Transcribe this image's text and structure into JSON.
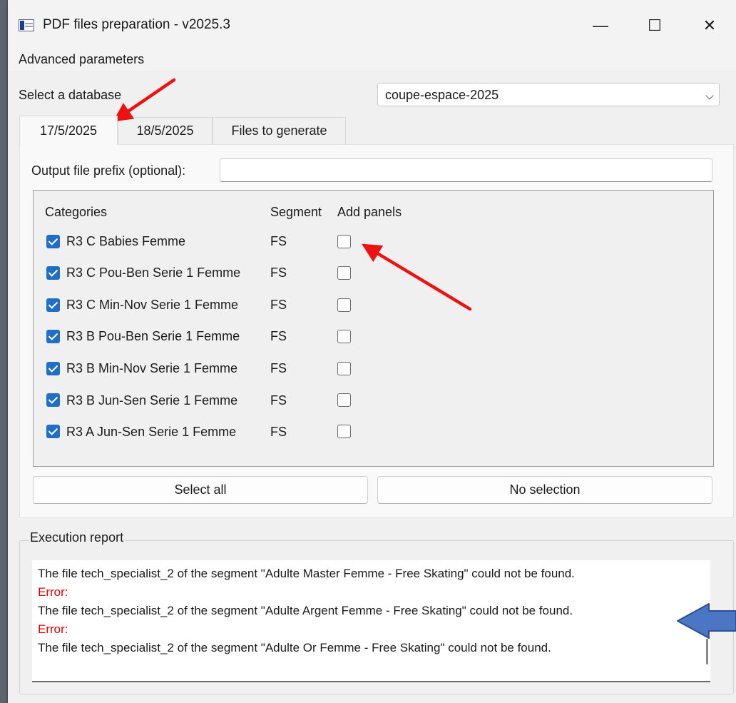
{
  "window": {
    "title": "PDF files preparation - v2025.3",
    "minimize_glyph": "—",
    "maximize_glyph": "☐",
    "close_glyph": "✕"
  },
  "menu": {
    "advanced_parameters": "Advanced parameters"
  },
  "database": {
    "label": "Select a database",
    "selected": "coupe-espace-2025"
  },
  "tabs": [
    {
      "label": "17/5/2025",
      "active": true
    },
    {
      "label": "18/5/2025",
      "active": false
    },
    {
      "label": "Files to generate",
      "active": false
    }
  ],
  "prefix": {
    "label": "Output file prefix (optional):",
    "value": ""
  },
  "categories": {
    "headers": {
      "categories": "Categories",
      "segment": "Segment",
      "add_panels": "Add panels"
    },
    "rows": [
      {
        "name": "R3 C Babies Femme",
        "segment": "FS",
        "selected": true,
        "add_panels": false
      },
      {
        "name": "R3 C Pou-Ben Serie 1 Femme",
        "segment": "FS",
        "selected": true,
        "add_panels": false
      },
      {
        "name": "R3 C Min-Nov Serie 1 Femme",
        "segment": "FS",
        "selected": true,
        "add_panels": false
      },
      {
        "name": "R3 B Pou-Ben Serie 1 Femme",
        "segment": "FS",
        "selected": true,
        "add_panels": false
      },
      {
        "name": "R3 B Min-Nov Serie 1 Femme",
        "segment": "FS",
        "selected": true,
        "add_panels": false
      },
      {
        "name": "R3 B Jun-Sen Serie 1 Femme",
        "segment": "FS",
        "selected": true,
        "add_panels": false
      },
      {
        "name": "R3 A Jun-Sen Serie 1 Femme",
        "segment": "FS",
        "selected": true,
        "add_panels": false
      }
    ]
  },
  "buttons": {
    "select_all": "Select all",
    "no_selection": "No selection"
  },
  "report": {
    "title": "Execution report",
    "lines": [
      {
        "type": "msg",
        "text": "The file tech_specialist_2 of the segment \"Adulte Master Femme - Free Skating\" could not be found."
      },
      {
        "type": "err",
        "text": "Error:"
      },
      {
        "type": "msg",
        "text": "The file tech_specialist_2 of the segment \"Adulte Argent Femme - Free Skating\" could not be found."
      },
      {
        "type": "err",
        "text": "Error:"
      },
      {
        "type": "msg",
        "text": "The file tech_specialist_2 of the segment \"Adulte Or Femme - Free Skating\" could not be found."
      }
    ]
  },
  "colors": {
    "accent": "#1f6fc7",
    "error_text": "#e00000",
    "annotation_red": "#ee1111",
    "annotation_blue": "#4a76c4"
  }
}
